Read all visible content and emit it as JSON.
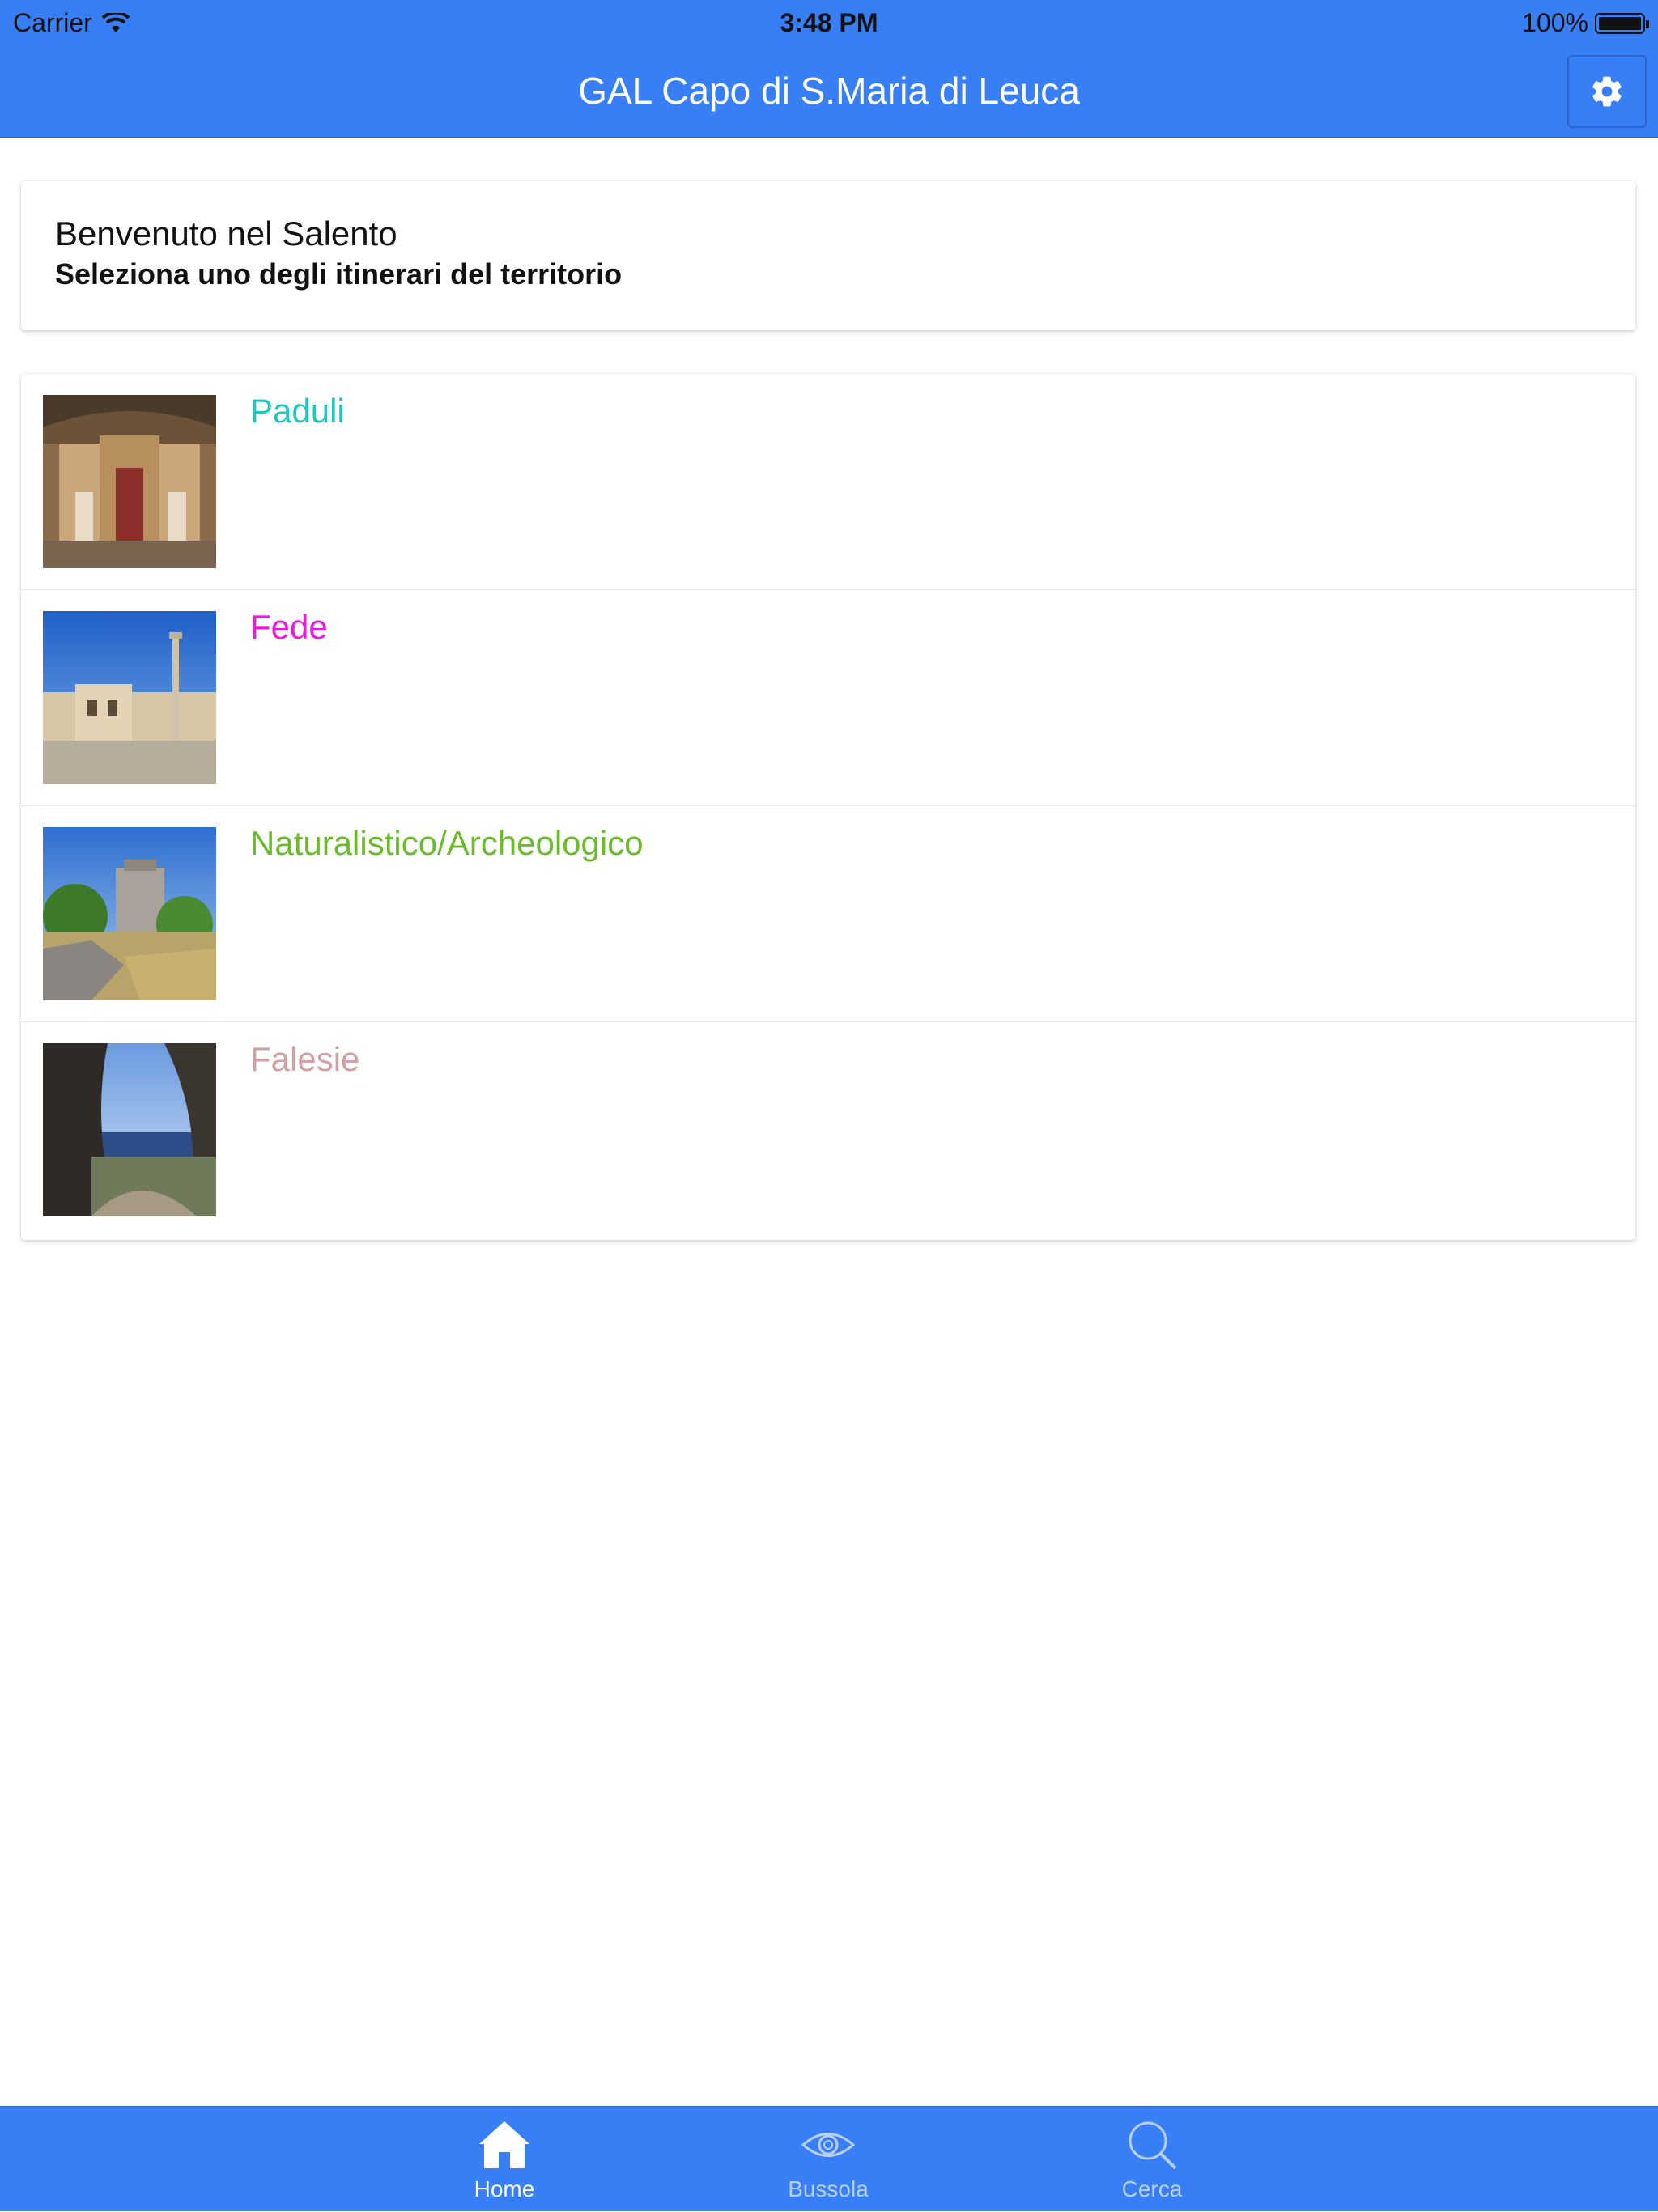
{
  "status_bar": {
    "carrier": "Carrier",
    "time": "3:48 PM",
    "battery": "100%"
  },
  "header": {
    "title": "GAL Capo di S.Maria di Leuca",
    "settings_icon": "gear-icon",
    "color": "#387ef5"
  },
  "welcome": {
    "title": "Benvenuto nel Salento",
    "subtitle": "Seleziona uno degli itinerari del territorio"
  },
  "itineraries": [
    {
      "label": "Paduli",
      "color": "#1ec8c0"
    },
    {
      "label": "Fede",
      "color": "#ee18e0"
    },
    {
      "label": "Naturalistico/Archeologico",
      "color": "#6cbb2c"
    },
    {
      "label": "Falesie",
      "color": "#d2a0a2"
    }
  ],
  "tabs": [
    {
      "label": "Home",
      "icon": "home-icon",
      "active": true
    },
    {
      "label": "Bussola",
      "icon": "eye-icon",
      "active": false
    },
    {
      "label": "Cerca",
      "icon": "search-icon",
      "active": false
    }
  ]
}
